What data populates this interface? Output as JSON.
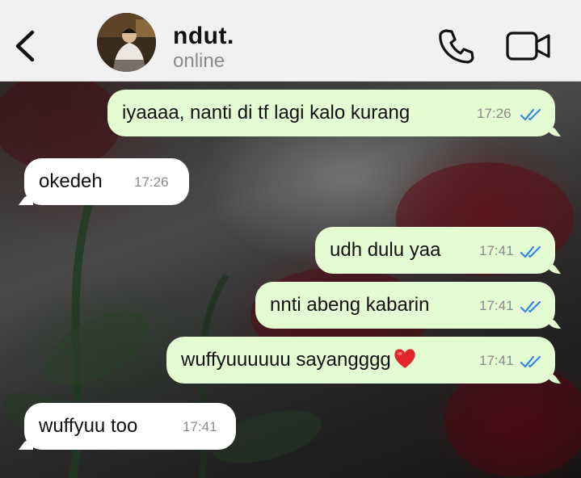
{
  "header": {
    "contact_name": "ndut.",
    "contact_status": "online"
  },
  "messages": [
    {
      "direction": "outgoing",
      "text": "iyaaaa, nanti di tf lagi kalo kurang",
      "time": "17:26",
      "read": true
    },
    {
      "direction": "incoming",
      "text": "okedeh",
      "time": "17:26"
    },
    {
      "direction": "outgoing",
      "text": "udh dulu yaa",
      "time": "17:41",
      "read": true
    },
    {
      "direction": "outgoing",
      "text": "nnti abeng kabarin",
      "time": "17:41",
      "read": true
    },
    {
      "direction": "outgoing",
      "text": "wuffyuuuuuu sayangggg",
      "emoji": "red-heart",
      "time": "17:41",
      "read": true
    },
    {
      "direction": "incoming",
      "text": "wuffyuu too",
      "time": "17:41"
    }
  ],
  "colors": {
    "outgoing_bubble": "#e4fcd4",
    "incoming_bubble": "#ffffff",
    "read_ticks": "#3a86d8",
    "header_bg": "#f1f1f1"
  },
  "icons": [
    "back-chevron-icon",
    "phone-icon",
    "video-camera-icon",
    "double-check-icon",
    "red-heart-emoji"
  ]
}
